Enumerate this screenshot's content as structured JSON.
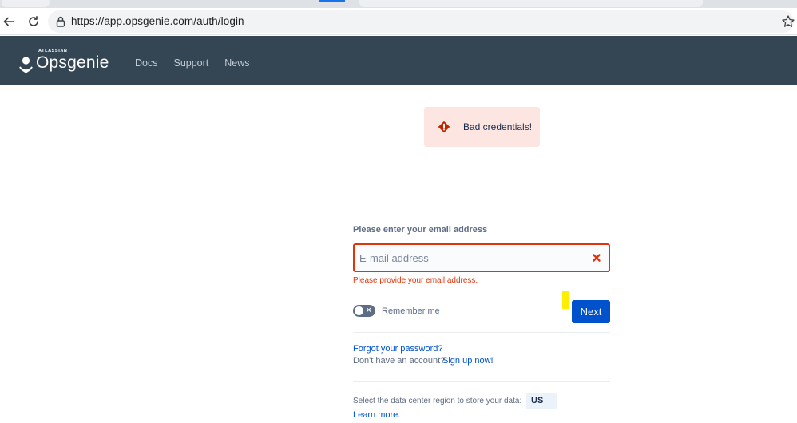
{
  "browser": {
    "url": "https://app.opsgenie.com/auth/login"
  },
  "header": {
    "brand_super": "ATLASSIAN",
    "brand": "Opsgenie",
    "nav": [
      "Docs",
      "Support",
      "News"
    ],
    "bg_color": "#344654"
  },
  "alert": {
    "message": "Bad credentials!",
    "icon": "error-diamond-icon",
    "color": "#de350b"
  },
  "login": {
    "email_label": "Please enter your email address",
    "email_placeholder": "E-mail address",
    "email_value": "",
    "email_error": "Please provide your email address.",
    "remember_label": "Remember me",
    "remember_checked": false,
    "next_label": "Next",
    "forgot_label": "Forgot your password?",
    "no_account_text": "Don't have an account?",
    "signup_label": "Sign up now!",
    "region_label": "Select the data center region to store your data:",
    "region_value": "US",
    "learn_more_label": "Learn more.",
    "accent_color": "#0052cc"
  }
}
